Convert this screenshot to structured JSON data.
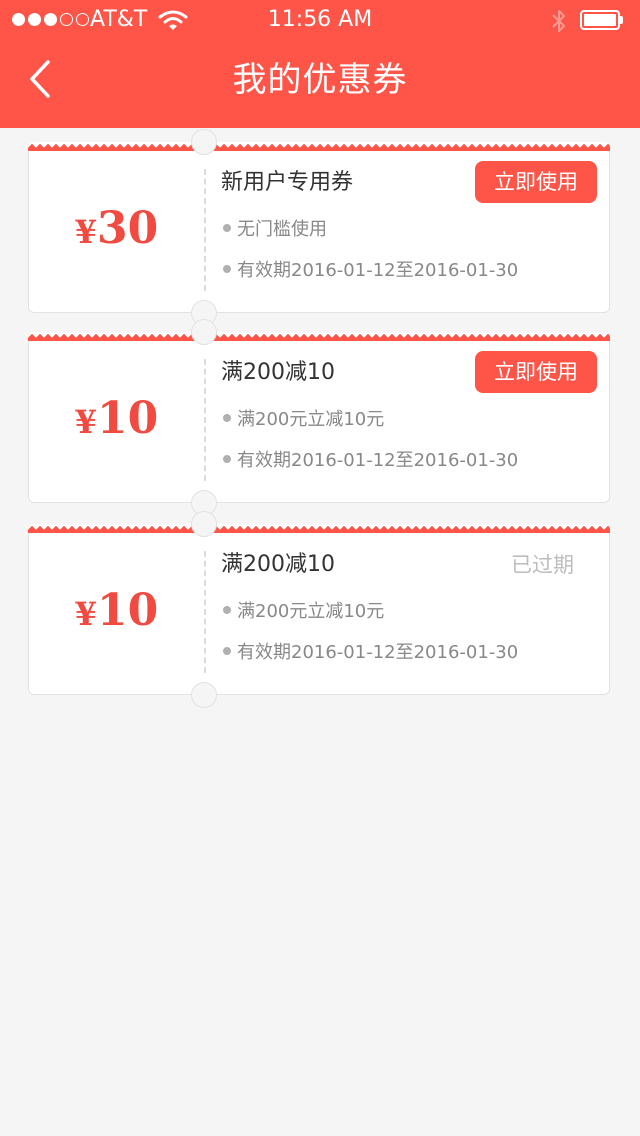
{
  "status_bar": {
    "carrier": "AT&T",
    "time": "11:56 AM",
    "signal_bars": 3,
    "signal_total": 5
  },
  "nav": {
    "title": "我的优惠券",
    "back_icon": "chevron-left-icon"
  },
  "colors": {
    "accent": "#ff5549",
    "amount": "#f04a41",
    "expired": "#bdbdbd"
  },
  "coupons": [
    {
      "currency": "¥",
      "amount": "30",
      "name": "新用户专用券",
      "condition": "无门槛使用",
      "validity": "有效期2016-01-12至2016-01-30",
      "action_label": "立即使用",
      "status": ""
    },
    {
      "currency": "¥",
      "amount": "10",
      "name": "满200减10",
      "condition": "满200元立减10元",
      "validity": "有效期2016-01-12至2016-01-30",
      "action_label": "立即使用",
      "status": ""
    },
    {
      "currency": "¥",
      "amount": "10",
      "name": "满200减10",
      "condition": "满200元立减10元",
      "validity": "有效期2016-01-12至2016-01-30",
      "action_label": "",
      "status": "已过期"
    }
  ]
}
